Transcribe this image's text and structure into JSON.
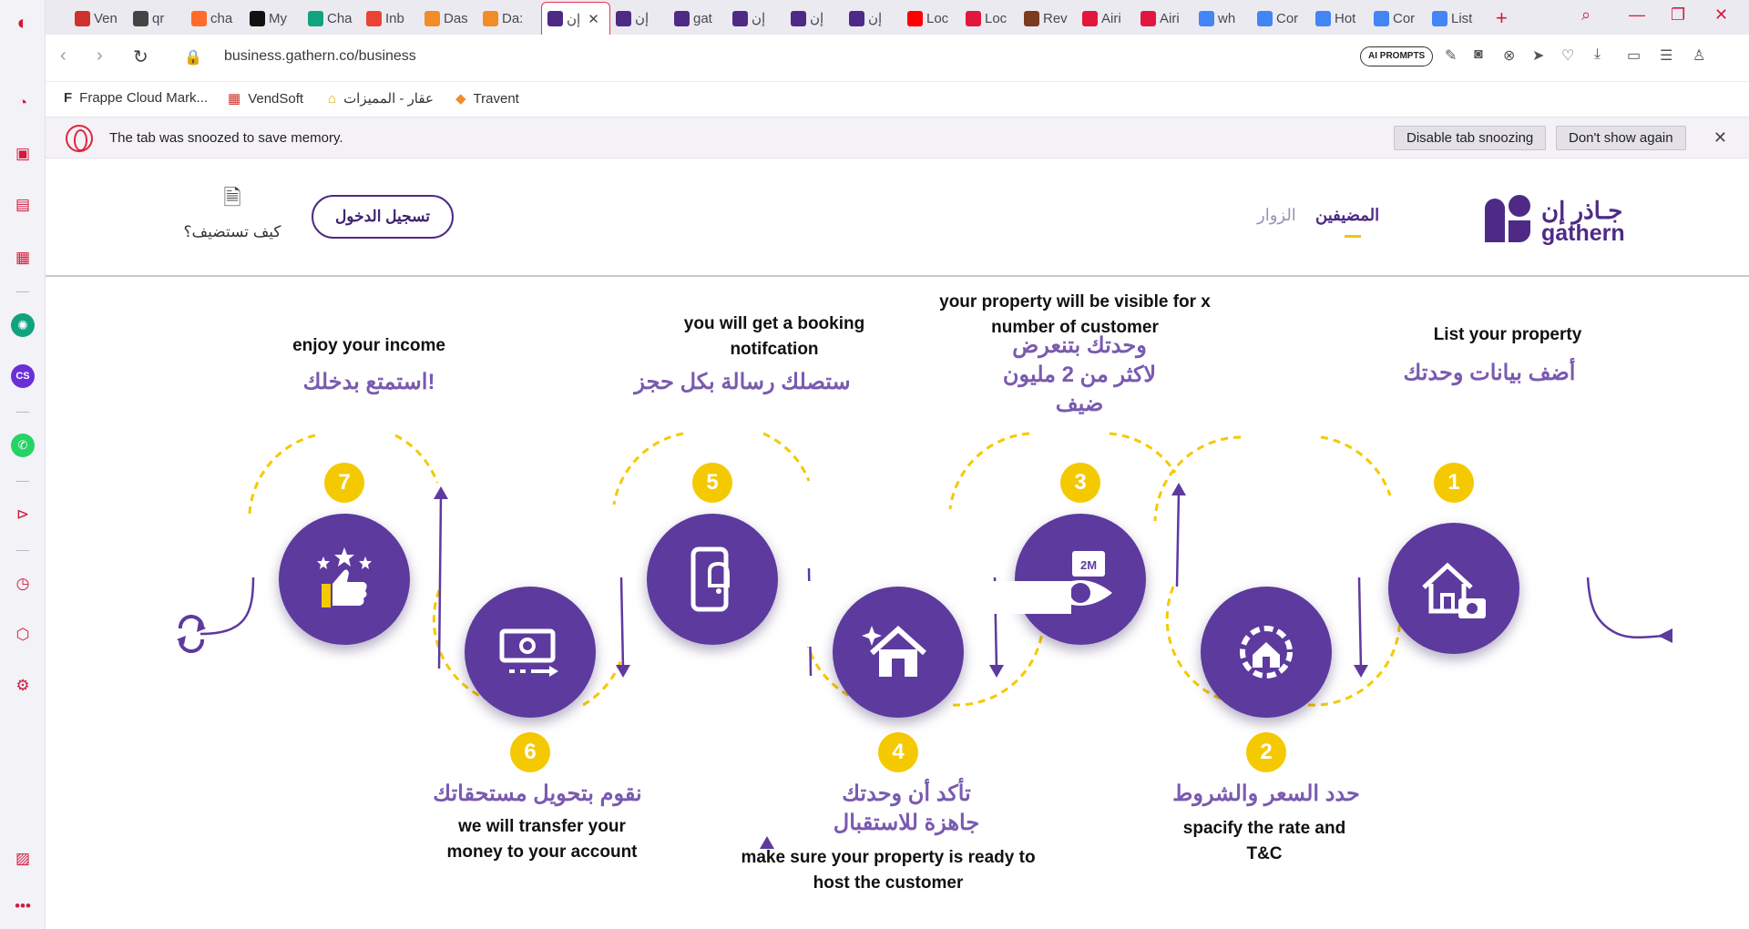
{
  "browser": {
    "tabs": [
      {
        "label": "Ven",
        "color": "#d0312d"
      },
      {
        "label": "qr",
        "color": "#444"
      },
      {
        "label": "cha",
        "color": "#ff6b2b"
      },
      {
        "label": "My",
        "color": "#111"
      },
      {
        "label": "Cha",
        "color": "#10a37f"
      },
      {
        "label": "Inb",
        "color": "#ea4335"
      },
      {
        "label": "Das",
        "color": "#f28c28"
      },
      {
        "label": "Da:",
        "color": "#f28c28"
      },
      {
        "label": "إن",
        "color": "#4e2a86",
        "active": true
      },
      {
        "label": "إن",
        "color": "#4e2a86"
      },
      {
        "label": "gat",
        "color": "#4e2a86"
      },
      {
        "label": "إن",
        "color": "#4e2a86"
      },
      {
        "label": "إن",
        "color": "#4e2a86"
      },
      {
        "label": "إن",
        "color": "#4e2a86"
      },
      {
        "label": "Loc",
        "color": "#ff0000"
      },
      {
        "label": "Loc",
        "color": "#e3173e"
      },
      {
        "label": "Rev",
        "color": "#7a3b1e"
      },
      {
        "label": "Airi",
        "color": "#e3173e"
      },
      {
        "label": "Airi",
        "color": "#e3173e"
      },
      {
        "label": "wh",
        "color": "#4285f4"
      },
      {
        "label": "Cor",
        "color": "#4285f4"
      },
      {
        "label": "Hot",
        "color": "#4285f4"
      },
      {
        "label": "Cor",
        "color": "#4285f4"
      },
      {
        "label": "List",
        "color": "#4285f4"
      }
    ],
    "new_tab": "+",
    "url": "business.gathern.co/business",
    "ai_prompts_label": "AI PROMPTS",
    "bookmarks": [
      {
        "label": "Frappe Cloud Mark...",
        "icon": "F"
      },
      {
        "label": "VendSoft",
        "icon": "▦"
      },
      {
        "label": "عقار - المميزات",
        "icon": "⌂"
      },
      {
        "label": "Travent",
        "icon": "◆"
      }
    ],
    "snooze": {
      "message": "The tab was snoozed to save memory.",
      "disable_label": "Disable tab snoozing",
      "dont_show_label": "Don't show again",
      "close": "✕"
    }
  },
  "header": {
    "logo_ar": "جـاذر إن",
    "logo_en": "gathern",
    "nav_hosts": "المضيفين",
    "nav_guests": "الزوار",
    "login_label": "تسجيل الدخول",
    "how_to_host": "كيف تستضيف؟"
  },
  "steps": [
    {
      "number": "1",
      "ar": "أضف بيانات وحدتك",
      "en": "List your property"
    },
    {
      "number": "2",
      "ar": "حدد السعر والشروط",
      "en": "spacify the rate and T&C"
    },
    {
      "number": "3",
      "ar": "وحدتك بتنعرض لاكثر من 2 مليون ضيف",
      "en": "your property will be visible for x number of customer"
    },
    {
      "number": "4",
      "ar": "تأكد أن وحدتك جاهزة للاستقبال",
      "en": "make sure your property is ready to host the customer"
    },
    {
      "number": "5",
      "ar": "ستصلك رسالة بكل حجز",
      "en": "you will get a booking notifcation"
    },
    {
      "number": "6",
      "ar": "نقوم بتحويل مستحقاتك",
      "en": "we will transfer your money to your account"
    },
    {
      "number": "7",
      "ar": "استمتع بدخلك!",
      "en": "enjoy your income"
    }
  ],
  "icon_badge_2m": "2M",
  "colors": {
    "purple": "#5d3a9e",
    "purple_dark": "#4e2a86",
    "yellow": "#f5c900",
    "opera_red": "#d11a3c"
  }
}
